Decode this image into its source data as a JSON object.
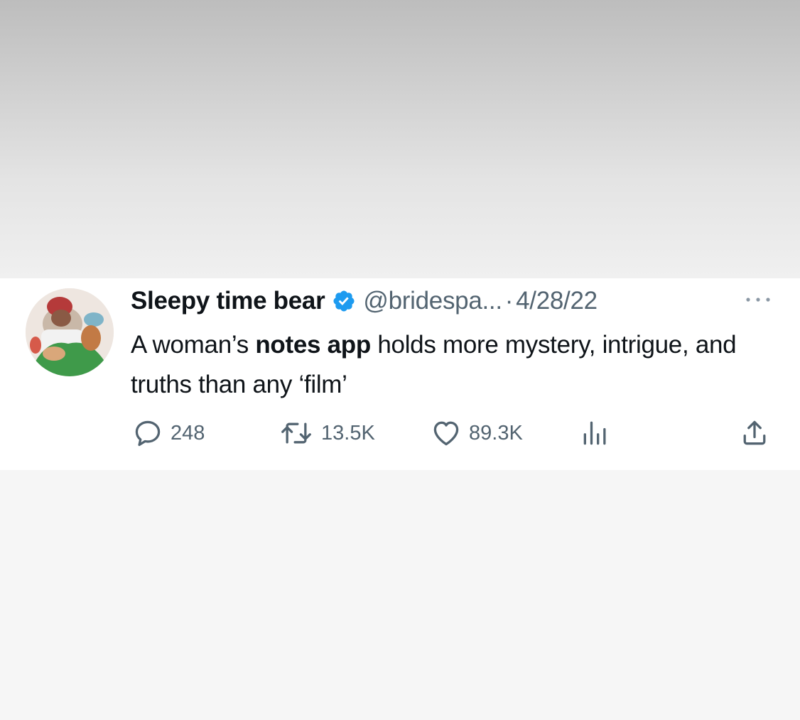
{
  "tweet": {
    "display_name": "Sleepy time bear",
    "handle": "@bridespa...",
    "separator": "·",
    "date": "4/28/22",
    "text_before": "A woman’s ",
    "text_bold": "notes app",
    "text_after": " holds more mystery, intrigue, and truths than any ‘film’",
    "replies": "248",
    "retweets": "13.5K",
    "likes": "89.3K"
  },
  "colors": {
    "verified": "#1d9bf0",
    "text": "#0f1419",
    "secondary": "#536471"
  },
  "icons": [
    "verified-badge-icon",
    "more-icon",
    "reply-icon",
    "retweet-icon",
    "like-icon",
    "views-icon",
    "share-icon"
  ]
}
